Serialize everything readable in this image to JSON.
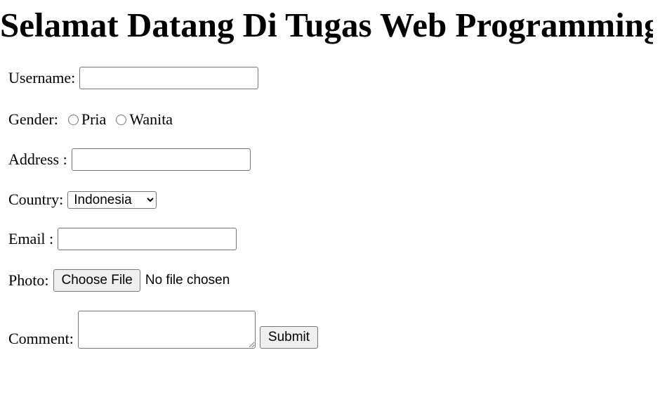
{
  "page": {
    "title": "Selamat Datang Di Tugas Web Programming"
  },
  "form": {
    "username": {
      "label": "Username:",
      "value": ""
    },
    "gender": {
      "label": "Gender:",
      "options": [
        "Pria",
        "Wanita"
      ],
      "selected": null
    },
    "address": {
      "label": "Address :",
      "value": ""
    },
    "country": {
      "label": "Country:",
      "selected": "Indonesia"
    },
    "email": {
      "label": "Email :",
      "value": ""
    },
    "photo": {
      "label": "Photo:",
      "button_label": "Choose File",
      "status": "No file chosen"
    },
    "comment": {
      "label": "Comment:",
      "value": ""
    },
    "submit_label": "Submit"
  }
}
